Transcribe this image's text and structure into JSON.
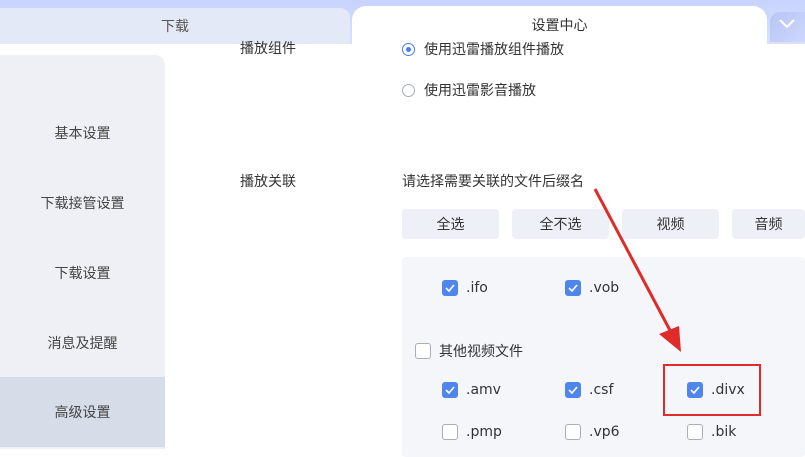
{
  "tabs": {
    "download": "下载",
    "settings": "设置中心"
  },
  "sidebar": {
    "items": [
      {
        "label": "基本设置"
      },
      {
        "label": "下载接管设置"
      },
      {
        "label": "下载设置"
      },
      {
        "label": "消息及提醒"
      },
      {
        "label": "高级设置"
      }
    ]
  },
  "playback_component": {
    "label": "播放组件",
    "options": [
      {
        "label": "使用迅雷播放组件播放",
        "selected": true
      },
      {
        "label": "使用迅雷影音播放",
        "selected": false
      }
    ]
  },
  "association": {
    "label": "播放关联",
    "hint": "请选择需要关联的文件后缀名",
    "buttons": [
      "全选",
      "全不选",
      "视频",
      "音频"
    ],
    "files_row1": [
      {
        "label": ".ifo",
        "checked": true
      },
      {
        "label": ".vob",
        "checked": true
      }
    ],
    "other_video": {
      "label": "其他视频文件",
      "checked": false
    },
    "files_row2": [
      {
        "label": ".amv",
        "checked": true
      },
      {
        "label": ".csf",
        "checked": true
      },
      {
        "label": ".divx",
        "checked": true
      }
    ],
    "files_row3": [
      {
        "label": ".pmp",
        "checked": false
      },
      {
        "label": ".vp6",
        "checked": false
      },
      {
        "label": ".bik",
        "checked": false
      }
    ]
  },
  "colors": {
    "accent": "#4f86ec",
    "annotation": "#e02b2b"
  }
}
